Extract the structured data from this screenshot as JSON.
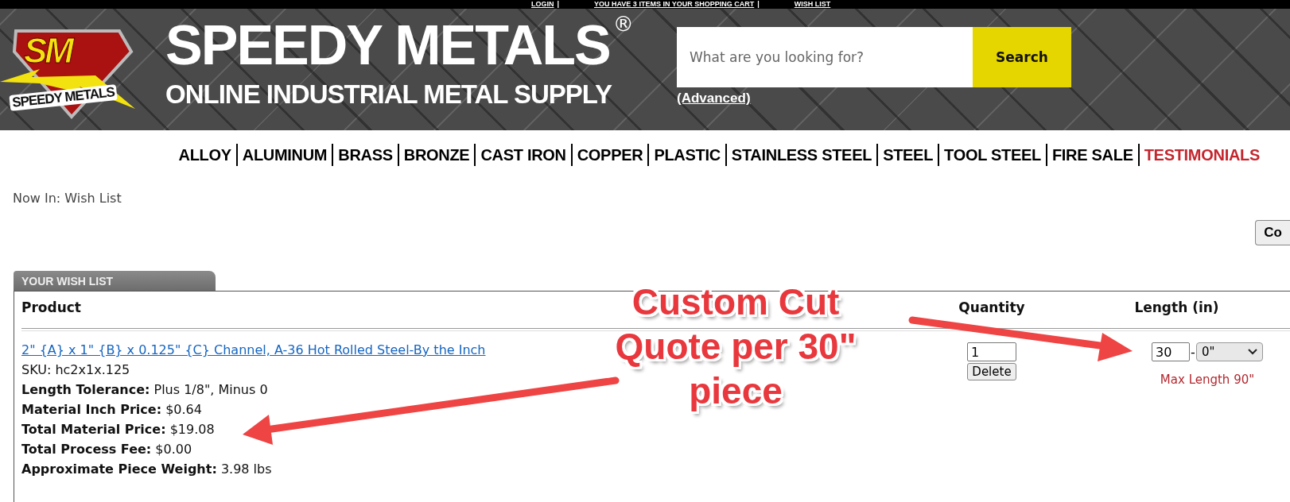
{
  "top_bar": {
    "links": [
      "LOGIN",
      "YOU HAVE 3 ITEMS IN YOUR SHOPPING CART",
      "WISH LIST"
    ],
    "separators": [
      "|",
      "|"
    ]
  },
  "logo": {
    "initials": "SM",
    "name": "SPEEDY METALS"
  },
  "header": {
    "title": "SPEEDY METALS",
    "trademark": "®",
    "tagline": "ONLINE INDUSTRIAL METAL SUPPLY"
  },
  "search": {
    "placeholder": "What are you looking for?",
    "button": "Search",
    "advanced_link": "(Advanced)"
  },
  "nav": {
    "items": [
      {
        "label": "ALLOY",
        "kind": "category"
      },
      {
        "label": "ALUMINUM",
        "kind": "category"
      },
      {
        "label": "BRASS",
        "kind": "category"
      },
      {
        "label": "BRONZE",
        "kind": "category"
      },
      {
        "label": "CAST IRON",
        "kind": "category"
      },
      {
        "label": "COPPER",
        "kind": "category"
      },
      {
        "label": "PLASTIC",
        "kind": "category"
      },
      {
        "label": "STAINLESS STEEL",
        "kind": "category"
      },
      {
        "label": "STEEL",
        "kind": "category"
      },
      {
        "label": "TOOL STEEL",
        "kind": "category"
      },
      {
        "label": "FIRE SALE",
        "kind": "category"
      },
      {
        "label": "TESTIMONIALS",
        "kind": "highlight"
      }
    ]
  },
  "breadcrumb": "Now In: Wish List",
  "side_button": "Co",
  "wish_list": {
    "tab": "YOUR WISH LIST",
    "columns": [
      "Product",
      "Quantity",
      "Length (in)"
    ],
    "items": [
      {
        "name": "2\" {A} x 1\" {B} x 0.125\" {C} Channel, A-36 Hot Rolled Steel-By the Inch",
        "sku": "SKU: hc2x1x.125",
        "details": [
          "**Length Tolerance:** Plus 1/8\", Minus 0",
          "**Material Inch Price:** $0.64",
          "**Total Material Price:** $19.08",
          "**Total Process Fee:** $0.00",
          "**Approximate Piece Weight:** 3.98 lbs"
        ],
        "quantity": "1",
        "delete": "Delete",
        "length": "30",
        "separator": "-",
        "fraction": "0\"",
        "max_length": "Max Length 90\""
      }
    ]
  },
  "annotation": {
    "lines": [
      "Custom Cut",
      "Quote per 30\"",
      "piece"
    ]
  }
}
